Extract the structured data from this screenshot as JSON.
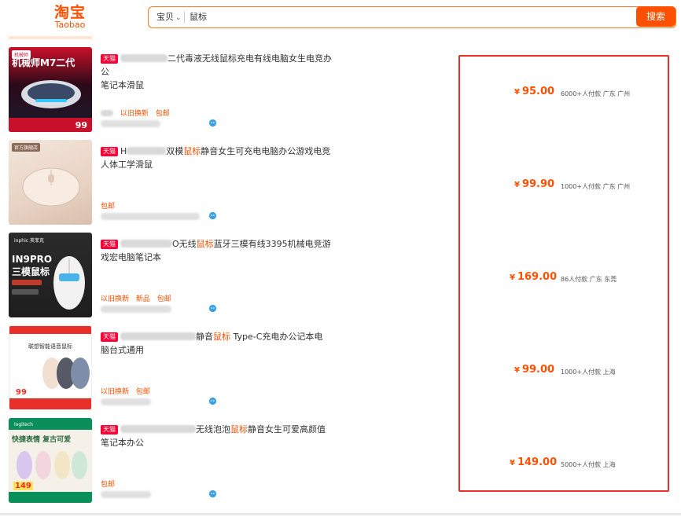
{
  "header": {
    "logo_cn": "淘宝",
    "logo_en": "Taobao",
    "search_type": "宝贝",
    "search_value": "鼠标",
    "search_button": "搜索"
  },
  "items": [
    {
      "badge": "天猫",
      "title_pre": "",
      "title_text": "二代毒液无线鼠标充电有线电脑女生电竞办公",
      "title_line2": "笔记本滑鼠",
      "title_highlight": "",
      "title_after": "",
      "tags": [
        "以旧换新",
        "包邮"
      ],
      "price": "95.00",
      "sales": "6000+人付款",
      "location": "广东 广州",
      "thumb_text": "机械师M7二代",
      "thumb_footer": "99"
    },
    {
      "badge": "天猫",
      "title_pre": "H",
      "title_text": "双模",
      "title_highlight": "鼠标",
      "title_after": "静音女生可充电电脑办公游戏电竞",
      "title_line2": "人体工学滑鼠",
      "tags": [
        "包邮"
      ],
      "price": "99.90",
      "sales": "1000+人付款",
      "location": "广东 广州",
      "thumb_text": "",
      "thumb_footer": ""
    },
    {
      "badge": "天猫",
      "title_pre": "",
      "title_text": "O无线",
      "title_highlight": "鼠标",
      "title_after": "蓝牙三模有线3395机械电竞游",
      "title_line2": "戏宏电脑笔记本",
      "tags": [
        "以旧换新",
        "新品",
        "包邮"
      ],
      "price": "169.00",
      "sales": "86人付款",
      "location": "广东 东莞",
      "thumb_text": "IN9PRO\n三模鼠标",
      "thumb_footer": ""
    },
    {
      "badge": "天猫",
      "title_pre": "",
      "title_text": "静音",
      "title_highlight": "鼠标",
      "title_after": " Type-C充电办公记本电",
      "title_line2": "脑台式通用",
      "tags": [
        "以旧换新",
        "包邮"
      ],
      "price": "99.00",
      "sales": "1000+人付款",
      "location": "上海",
      "thumb_text": "联想智能语音鼠标",
      "thumb_footer": "99"
    },
    {
      "badge": "天猫",
      "title_pre": "",
      "title_text": "无线泡泡",
      "title_highlight": "鼠标",
      "title_after": "静音女生可爱高颜值",
      "title_line2": "笔记本办公",
      "tags": [
        "包邮"
      ],
      "price": "149.00",
      "sales": "5000+人付款",
      "location": "上海",
      "thumb_text": "快捷表情 复古可爱",
      "thumb_footer": "149"
    }
  ],
  "colors": {
    "accent": "#ff5000",
    "frame": "#e8302a",
    "tmall": "#ff0036"
  }
}
